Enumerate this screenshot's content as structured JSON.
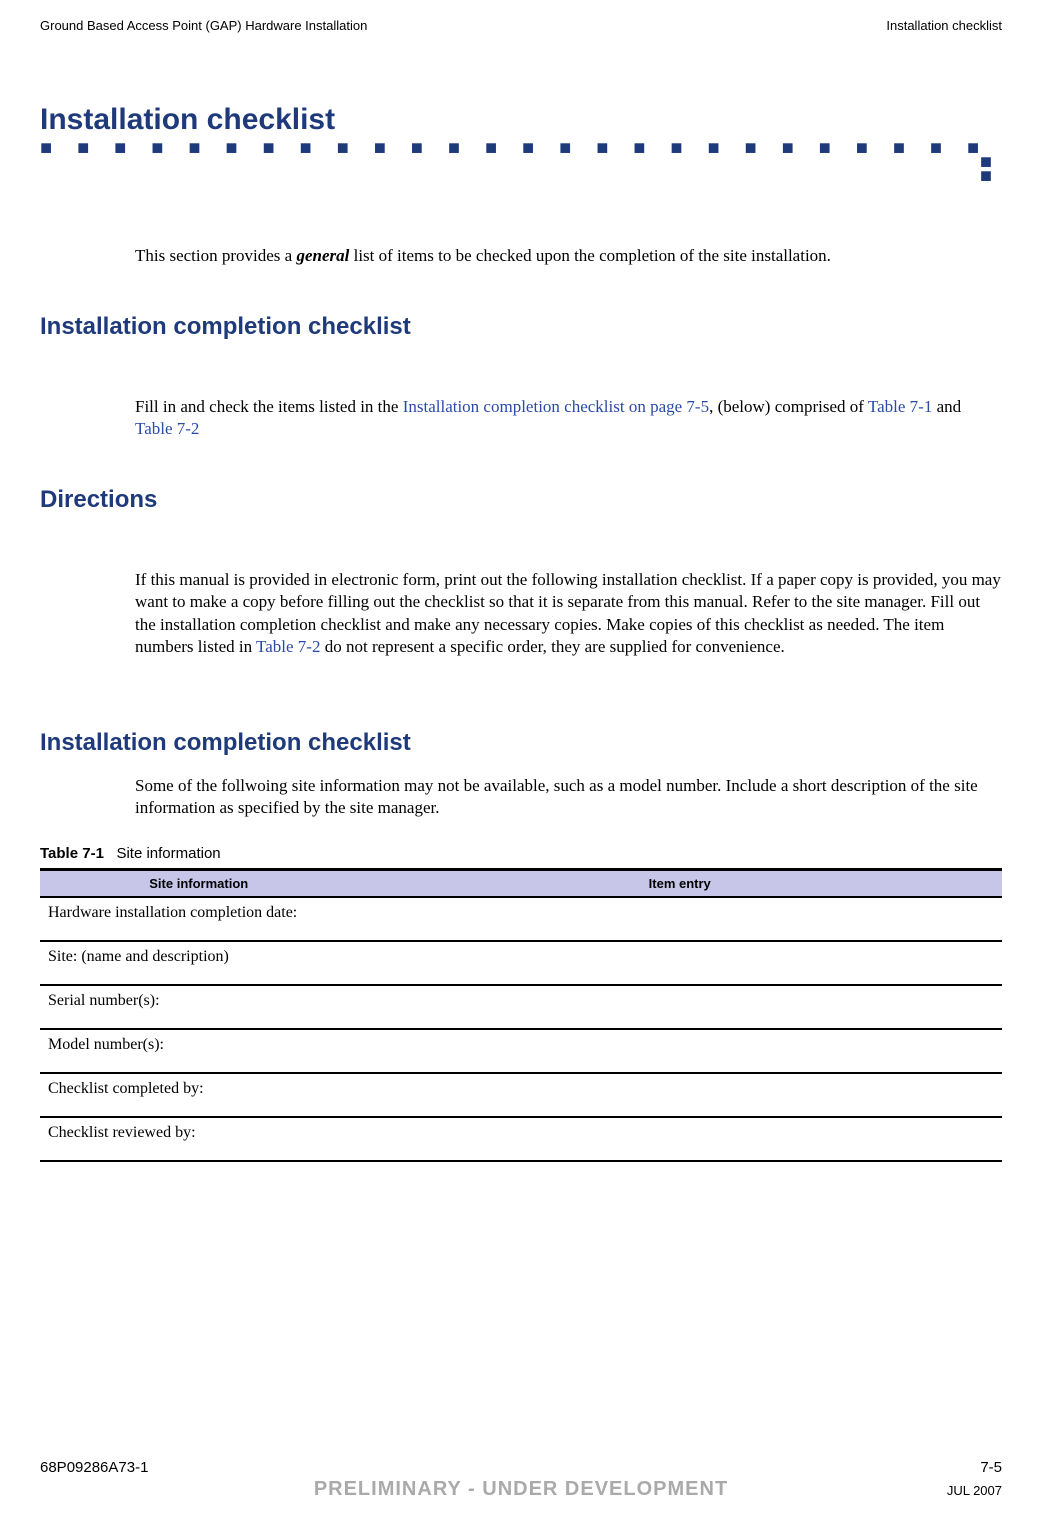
{
  "running_header": {
    "left": "Ground Based Access Point (GAP) Hardware Installation",
    "right": "Installation checklist"
  },
  "chapter": {
    "title": "Installation checklist"
  },
  "intro": {
    "before_general": "This section provides a ",
    "general": "general",
    "after_general": " list of items to be checked upon the completion of the site installation."
  },
  "sec_completion_checklist_1": {
    "heading": "Installation completion checklist",
    "para_before_link": "Fill in and check the items listed in the ",
    "link_text": "Installation completion checklist on page 7-5",
    "para_mid1": ", (below) comprised of ",
    "link_t71": "Table 7-1",
    "and_text": " and ",
    "link_t72": "Table 7-2"
  },
  "sec_directions": {
    "heading": "Directions",
    "para_before": "If this manual is provided in electronic form, print out the following installation checklist. If a paper copy is provided, you may want to make a copy before filling out the checklist so that it is separate from this manual. Refer to the site manager. Fill out the installation completion checklist and make any necessary copies. Make copies of this checklist as needed. The item numbers listed in ",
    "link_t72": "Table 7-2",
    "para_after": " do not represent a specific order, they are supplied for convenience."
  },
  "sec_completion_checklist_2": {
    "heading": "Installation completion checklist",
    "para": "Some of the follwoing site information may not be available, such as a model number. Include a short description of the site information as specified by the site manager."
  },
  "table71": {
    "caption_num": "Table 7-1",
    "caption_text": "Site information",
    "headers": {
      "col1": "Site information",
      "col2": "Item entry"
    },
    "rows": [
      {
        "label": "Hardware installation completion date:",
        "entry": ""
      },
      {
        "label": "Site: (name and description)",
        "entry": ""
      },
      {
        "label": "Serial number(s):",
        "entry": ""
      },
      {
        "label": "Model number(s):",
        "entry": ""
      },
      {
        "label": "Checklist completed by:",
        "entry": ""
      },
      {
        "label": "Checklist reviewed by:",
        "entry": ""
      }
    ]
  },
  "footer": {
    "doc_num": "68P09286A73-1",
    "page_num": "7-5",
    "prelim": "PRELIMINARY - UNDER DEVELOPMENT",
    "date": "JUL 2007"
  }
}
